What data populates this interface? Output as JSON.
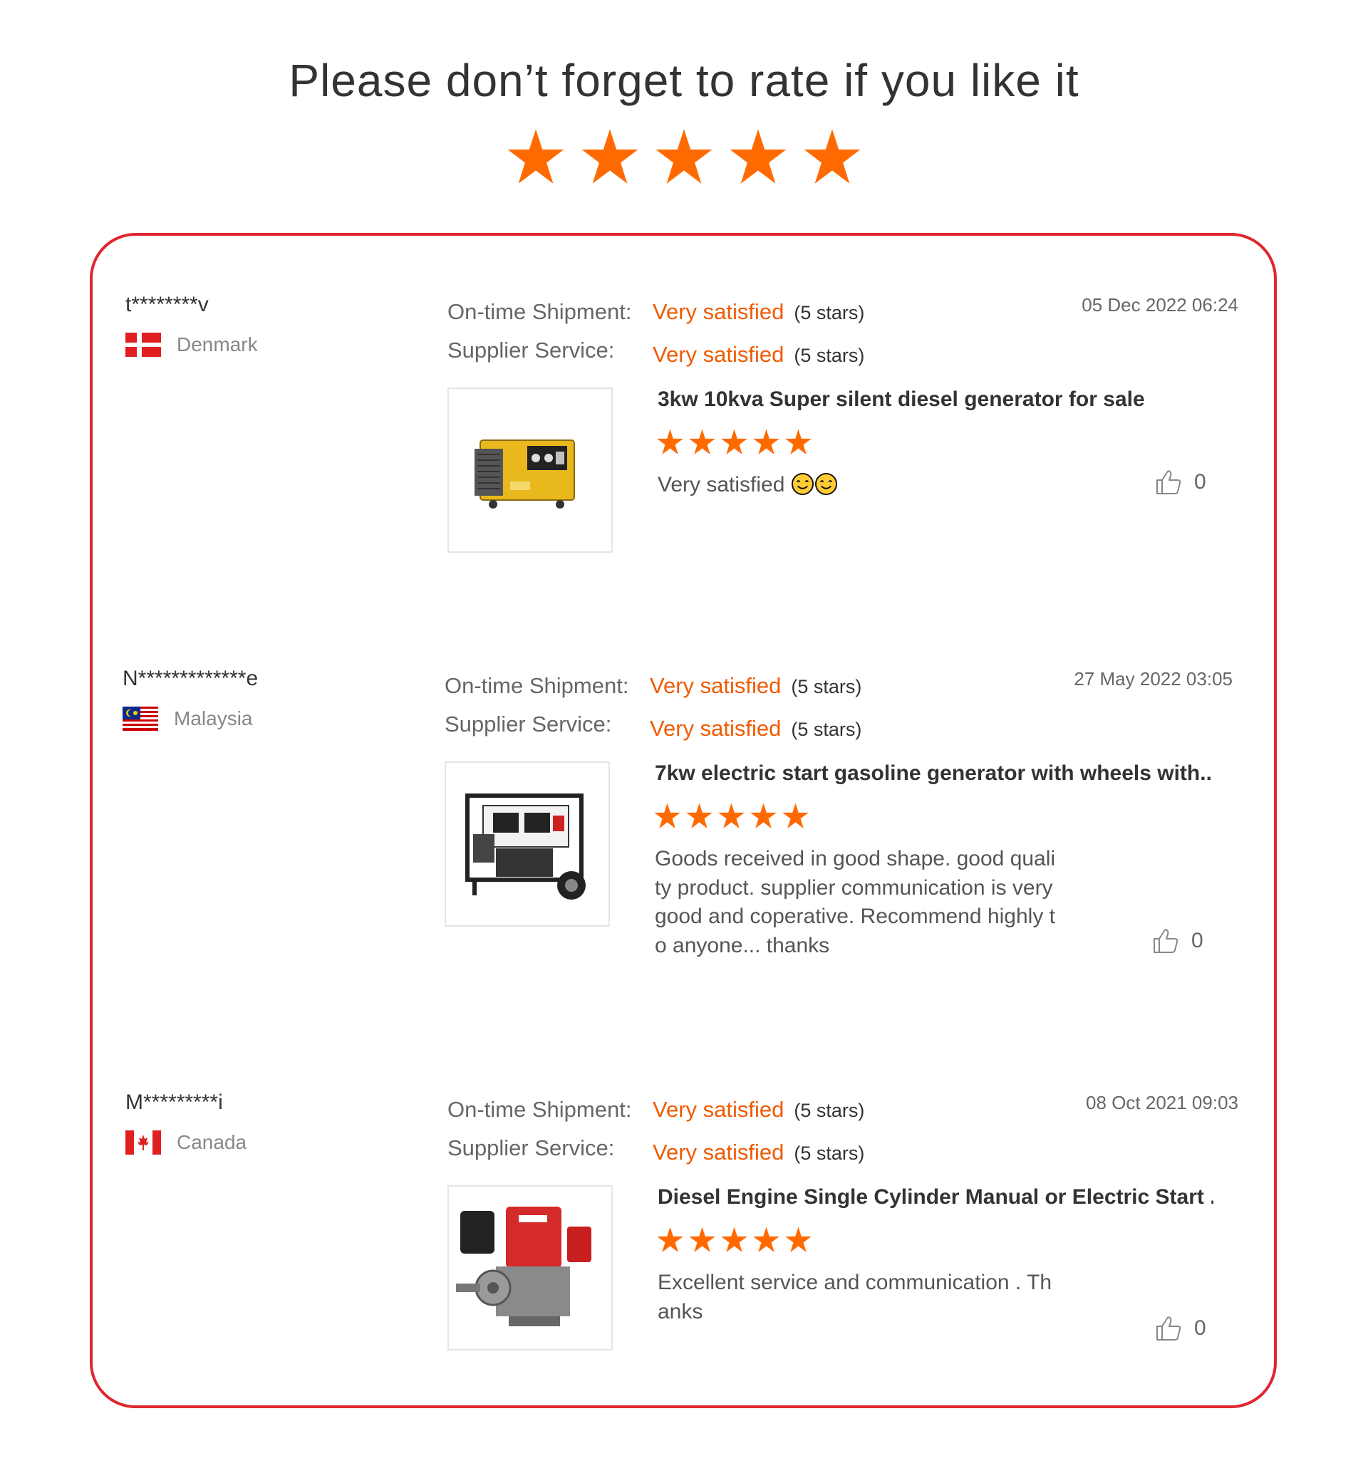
{
  "header": {
    "title": "Please don’t forget to rate if you like it",
    "stars": 5,
    "star_color": "#ff6a00"
  },
  "card_border_color": "#e0262e",
  "accent_color": "#f05a00",
  "reviews": [
    {
      "buyer": "t********v",
      "country": "Denmark",
      "flag_icon": "denmark-flag-icon",
      "labels": {
        "shipment": "On-time Shipment:",
        "service": "Supplier Service:"
      },
      "shipment_rating": "Very satisfied",
      "shipment_stars": "(5 stars)",
      "service_rating": "Very satisfied",
      "service_stars": "(5 stars)",
      "date": "05 Dec 2022 06:24",
      "product_title": "3kw 10kva Super silent diesel generator for sale",
      "product_icon": "silent-diesel-generator-image",
      "product_rating": 5,
      "text": "Very satisfied",
      "emojis": [
        "smile-emoji-icon",
        "smile-emoji-icon"
      ],
      "likes": "0"
    },
    {
      "buyer": "N*************e",
      "country": "Malaysia",
      "flag_icon": "malaysia-flag-icon",
      "labels": {
        "shipment": "On-time Shipment:",
        "service": "Supplier Service:"
      },
      "shipment_rating": "Very satisfied",
      "shipment_stars": "(5 stars)",
      "service_rating": "Very satisfied",
      "service_stars": "(5 stars)",
      "date": "27 May 2022 03:05",
      "product_title": "7kw electric start gasoline generator with wheels with...",
      "product_icon": "gasoline-generator-image",
      "product_rating": 5,
      "text": "Goods received in good shape. good quality product. supplier communication is very good and coperative. Recommend highly to anyone... thanks",
      "emojis": [],
      "likes": "0"
    },
    {
      "buyer": "M*********i",
      "country": "Canada",
      "flag_icon": "canada-flag-icon",
      "labels": {
        "shipment": "On-time Shipment:",
        "service": "Supplier Service:"
      },
      "shipment_rating": "Very satisfied",
      "shipment_stars": "(5 stars)",
      "service_rating": "Very satisfied",
      "service_stars": "(5 stars)",
      "date": "08 Oct 2021 09:03",
      "product_title": "Diesel Engine Single Cylinder Manual or Electric Start ...",
      "product_icon": "diesel-engine-image",
      "product_rating": 5,
      "text": "Excellent service and communication . Thanks",
      "emojis": [],
      "likes": "0"
    }
  ]
}
